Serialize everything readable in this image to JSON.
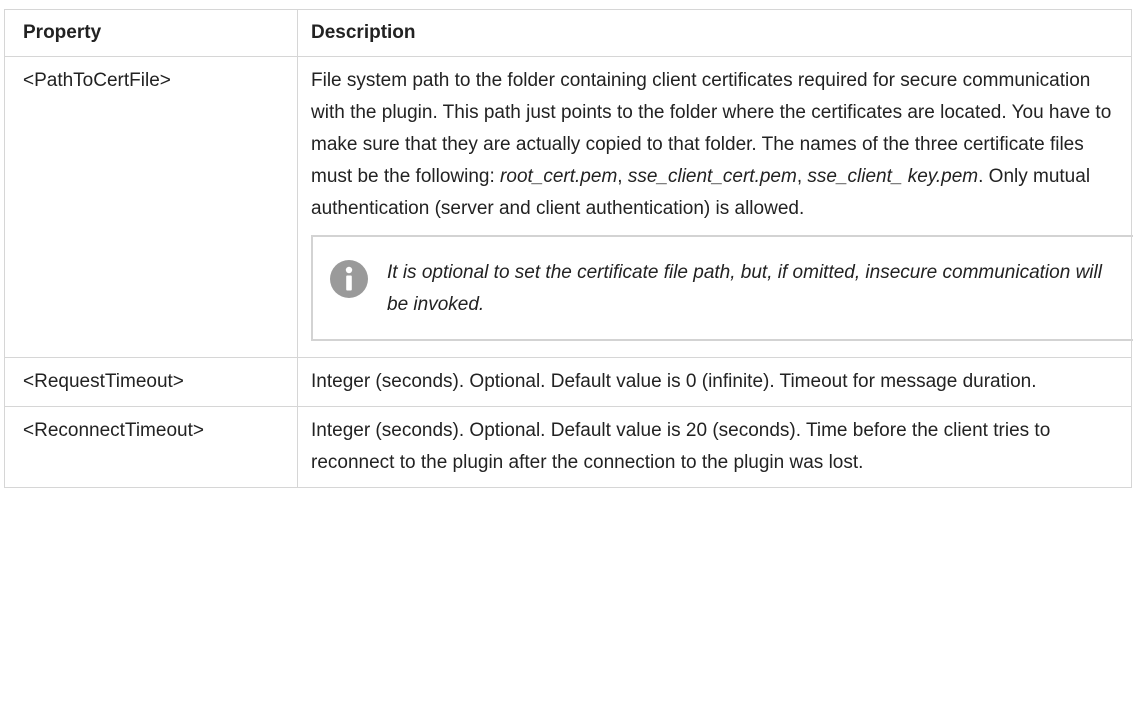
{
  "table": {
    "headers": {
      "property": "Property",
      "description": "Description"
    },
    "rows": [
      {
        "property": "<PathToCertFile>",
        "description_parts": {
          "text1": "File system path to the folder containing client certificates required for secure communication with the plugin. This path just points to the folder where the certificates are located. You have to make sure that they are actually copied to that folder. The names of the three certificate files must be the following: ",
          "file1": "root_cert.pem",
          "sep1": ", ",
          "file2": "sse_client_cert.pem",
          "sep2": ", ",
          "file3": "sse_client_ key.pem",
          "text2": ". Only mutual authentication (server and client authentication) is allowed."
        },
        "note": {
          "icon": "info-icon",
          "text": "It is optional to set the certificate file path, but, if omitted, insecure communication will be invoked."
        }
      },
      {
        "property": "<RequestTimeout>",
        "description": "Integer (seconds). Optional. Default value is 0 (infinite). Timeout for message duration."
      },
      {
        "property": "<ReconnectTimeout>",
        "description": "Integer (seconds). Optional. Default value is 20 (seconds). Time before the client tries to reconnect to the plugin after the connection to the plugin was lost."
      }
    ]
  },
  "colors": {
    "border": "#d6d6d6",
    "icon": "#9a9a9a",
    "text": "#222222"
  }
}
